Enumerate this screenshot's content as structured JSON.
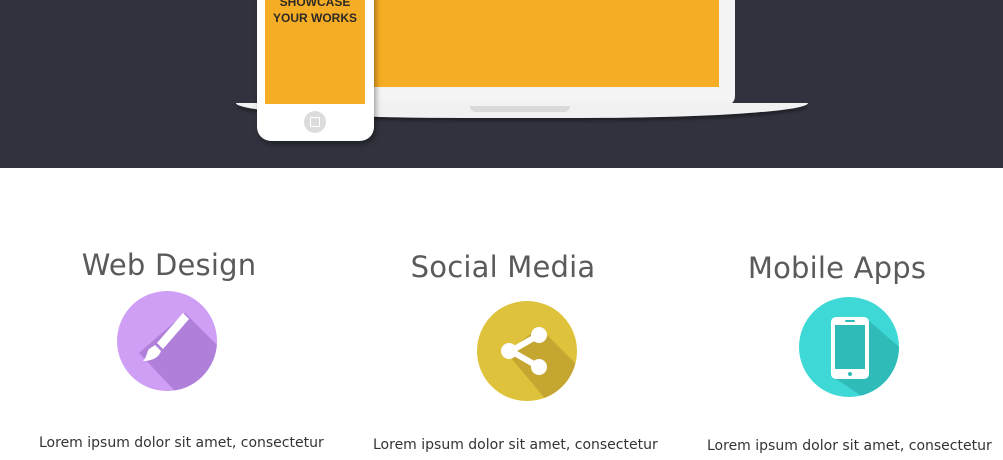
{
  "hero": {
    "phone_text_line1": "SHOWCASE",
    "phone_text_line2": "YOUR WORKS"
  },
  "features": [
    {
      "title": "Web Design",
      "icon": "paintbrush-icon",
      "color": "#cf9ff5",
      "text": "Lorem ipsum dolor sit amet, consectetur"
    },
    {
      "title": "Social Media",
      "icon": "share-icon",
      "color": "#dfc23b",
      "text": "Lorem ipsum dolor sit amet, consectetur"
    },
    {
      "title": "Mobile Apps",
      "icon": "smartphone-icon",
      "color": "#3ed9d6",
      "text": "Lorem ipsum dolor sit amet, consectetur"
    }
  ]
}
